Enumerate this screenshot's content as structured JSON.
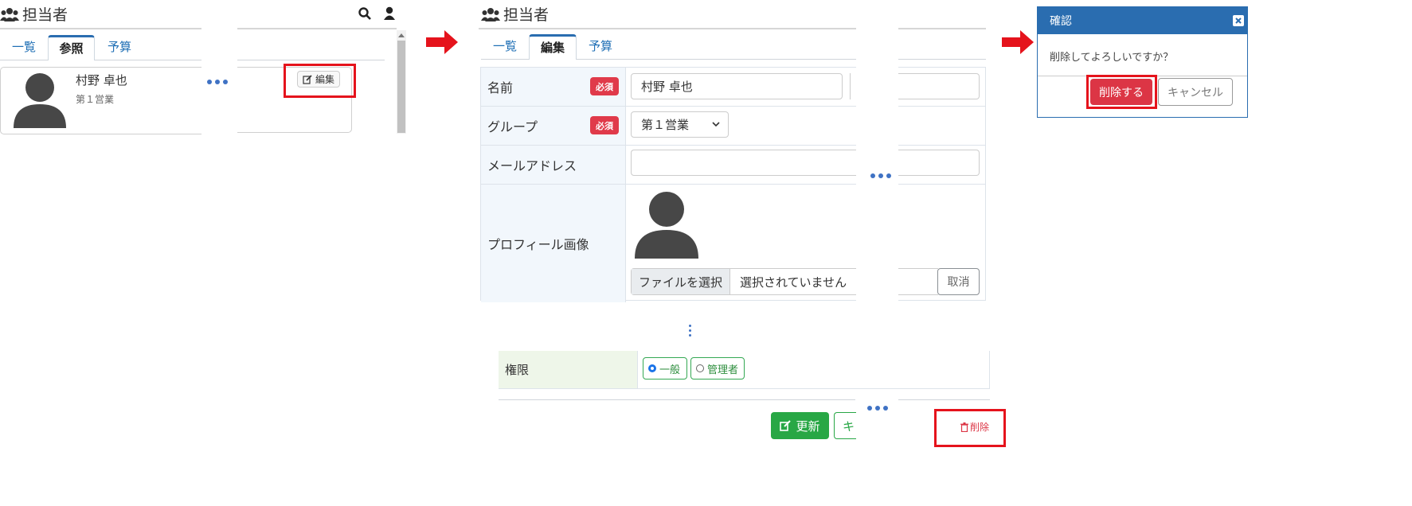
{
  "panel1": {
    "title": "担当者",
    "tabs": [
      "一覧",
      "参照",
      "予算"
    ],
    "person_name": "村野 卓也",
    "person_group": "第１営業",
    "edit_label": "編集"
  },
  "panel2": {
    "title": "担当者",
    "tabs": [
      "一覧",
      "編集",
      "予算"
    ],
    "required_badge": "必須",
    "fields": {
      "name_label": "名前",
      "name_value": "村野 卓也",
      "group_label": "グループ",
      "group_value": "第１営業",
      "email_label": "メールアドレス",
      "image_label": "プロフィール画像",
      "file_button": "ファイルを選択",
      "file_status": "選択されていません",
      "cancel_label": "取消"
    },
    "role_label": "権限",
    "role_options": [
      "一般",
      "管理者"
    ],
    "update_label": "更新",
    "cancel_partial": "キ",
    "delete_label": "削除"
  },
  "dialog": {
    "title": "確認",
    "message": "削除してよろしいですか？",
    "delete_button": "削除する",
    "cancel_button": "キャンセル"
  },
  "colors": {
    "accent_blue": "#2a6db0",
    "arrow_red": "#e5131c",
    "danger": "#dc3545",
    "success": "#28a745",
    "dialog_header": "#2a6db0"
  }
}
